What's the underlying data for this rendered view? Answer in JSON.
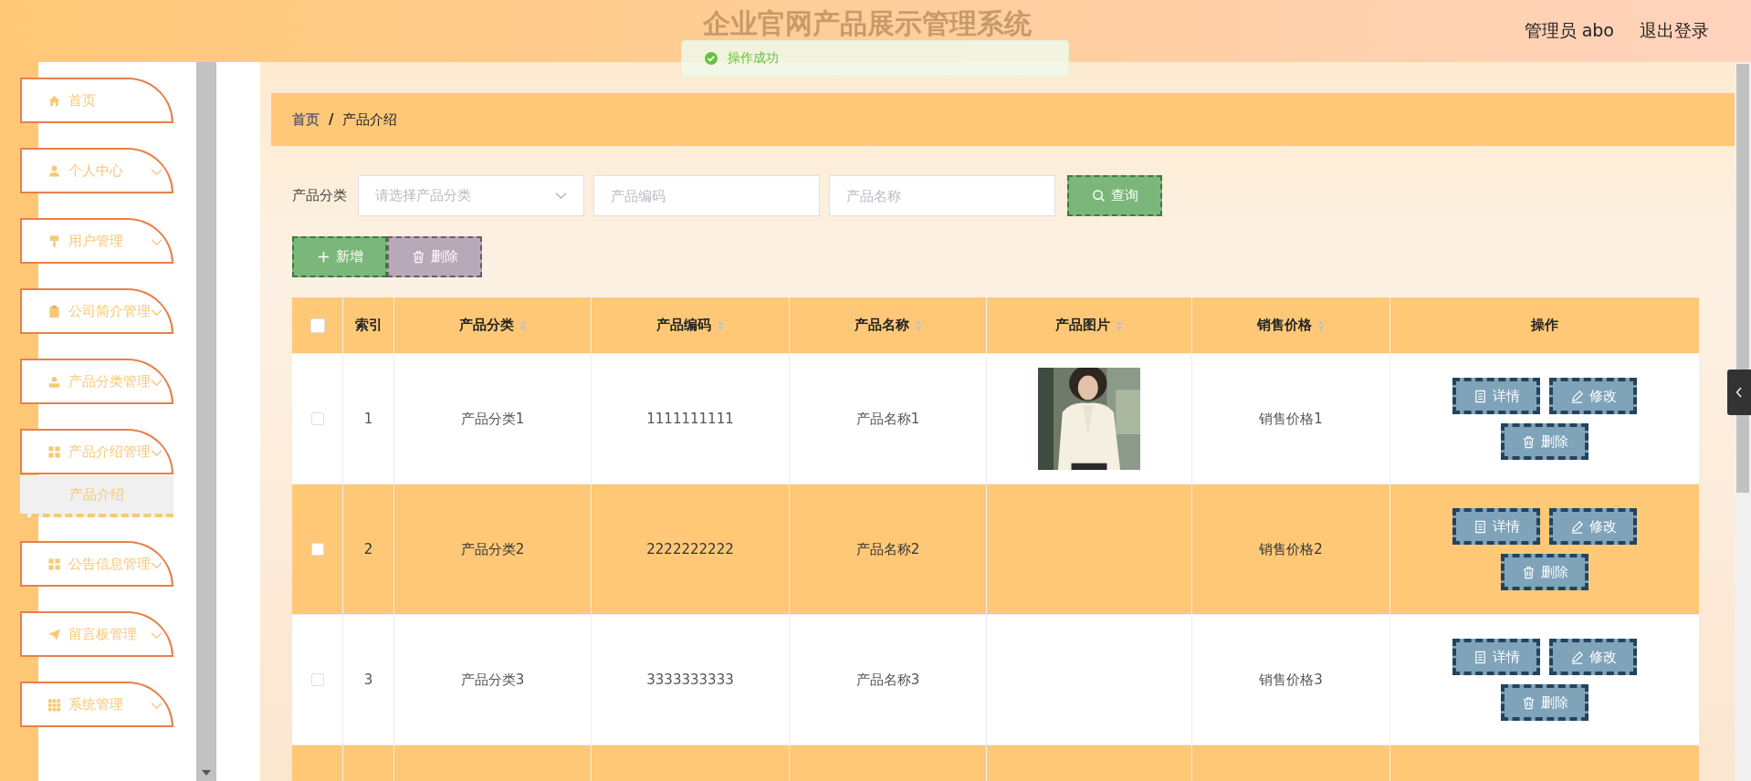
{
  "header": {
    "title": "企业官网产品展示管理系统",
    "user": "管理员 abo",
    "logout": "退出登录"
  },
  "toast": {
    "message": "操作成功"
  },
  "sidebar": {
    "items": [
      {
        "label": "首页",
        "expandable": false
      },
      {
        "label": "个人中心",
        "expandable": true
      },
      {
        "label": "用户管理",
        "expandable": true
      },
      {
        "label": "公司简介管理",
        "expandable": true
      },
      {
        "label": "产品分类管理",
        "expandable": true
      },
      {
        "label": "产品介绍管理",
        "expandable": true,
        "children": [
          {
            "label": "产品介绍",
            "selected": true
          }
        ]
      },
      {
        "label": "公告信息管理",
        "expandable": true
      },
      {
        "label": "留言板管理",
        "expandable": true
      },
      {
        "label": "系统管理",
        "expandable": true
      }
    ]
  },
  "breadcrumb": {
    "separator": "/",
    "items": [
      "首页",
      "产品介绍"
    ]
  },
  "filters": {
    "category_label": "产品分类",
    "category_placeholder": "请选择产品分类",
    "code_placeholder": "产品编码",
    "name_placeholder": "产品名称",
    "search_button": "查询"
  },
  "toolbar": [
    {
      "kind": "add",
      "label": "新增"
    },
    {
      "kind": "delete",
      "label": "删除"
    }
  ],
  "table": {
    "header_checked": false,
    "columns": [
      {
        "label": "索引",
        "sortable": false
      },
      {
        "label": "产品分类",
        "sortable": true
      },
      {
        "label": "产品编码",
        "sortable": true
      },
      {
        "label": "产品名称",
        "sortable": true
      },
      {
        "label": "产品图片",
        "sortable": true
      },
      {
        "label": "销售价格",
        "sortable": true
      },
      {
        "label": "操作",
        "sortable": false
      }
    ],
    "rows": [
      {
        "checked": false,
        "cells": [
          "1",
          "产品分类1",
          "1111111111",
          "产品名称1"
        ],
        "picture": {
          "kind": "picture"
        },
        "price": "销售价格1",
        "actions": [
          {
            "kind": "detail",
            "label": "详情"
          },
          {
            "kind": "edit",
            "label": "修改"
          },
          {
            "kind": "delete",
            "label": "删除"
          }
        ]
      },
      {
        "checked": false,
        "cells": [
          "2",
          "产品分类2",
          "2222222222",
          "产品名称2"
        ],
        "price": "销售价格2",
        "actions": [
          {
            "kind": "detail",
            "label": "详情"
          },
          {
            "kind": "edit",
            "label": "修改"
          },
          {
            "kind": "delete",
            "label": "删除"
          }
        ]
      },
      {
        "checked": false,
        "cells": [
          "3",
          "产品分类3",
          "3333333333",
          "产品名称3"
        ],
        "price": "销售价格3",
        "actions": [
          {
            "kind": "detail",
            "label": "详情"
          },
          {
            "kind": "edit",
            "label": "修改"
          },
          {
            "kind": "delete",
            "label": "删除"
          }
        ]
      }
    ]
  }
}
